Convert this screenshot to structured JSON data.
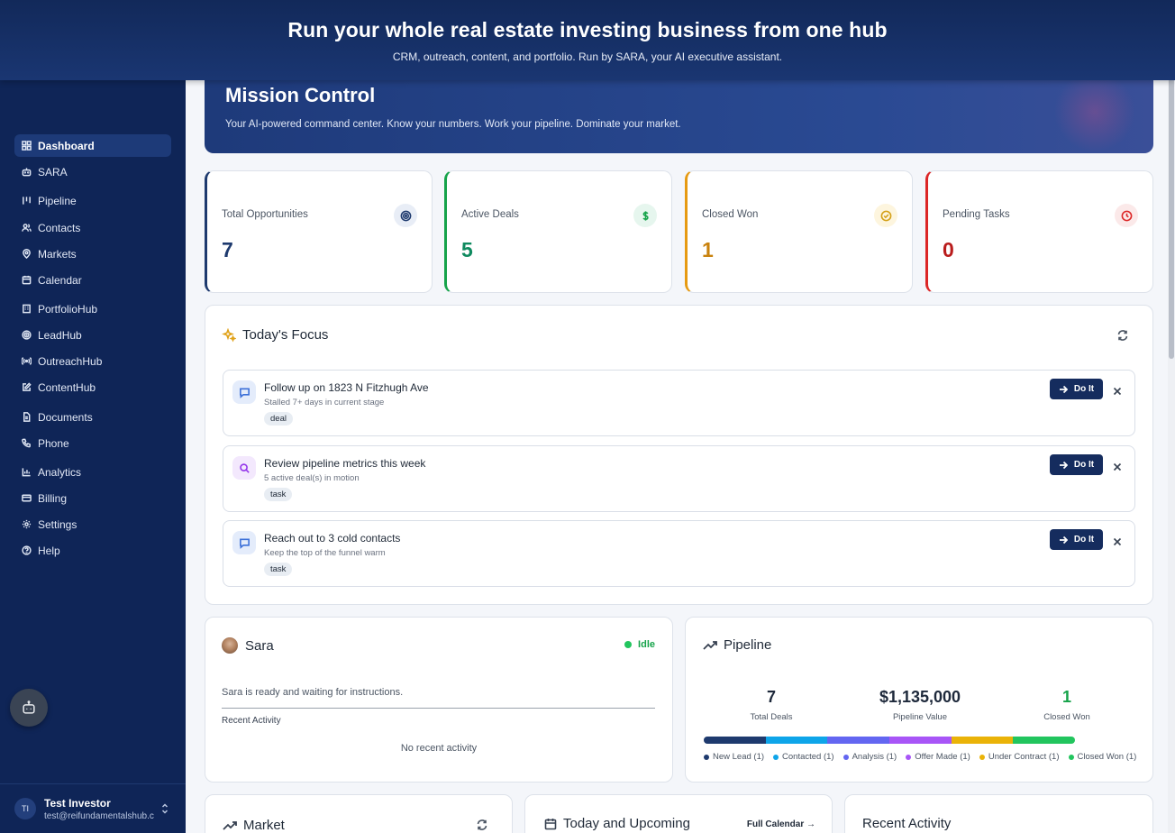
{
  "banner": {
    "title": "Run your whole real estate investing business from one hub",
    "subtitle": "CRM, outreach, content, and portfolio. Run by SARA, your AI executive assistant."
  },
  "sidebar": {
    "items": [
      {
        "label": "Dashboard",
        "icon": "grid-icon",
        "active": true
      },
      {
        "label": "SARA",
        "icon": "robot-icon"
      },
      {
        "label": "Pipeline",
        "icon": "kanban-icon"
      },
      {
        "label": "Contacts",
        "icon": "users-icon"
      },
      {
        "label": "Markets",
        "icon": "map-pin-icon"
      },
      {
        "label": "Calendar",
        "icon": "calendar-icon"
      },
      {
        "label": "PortfolioHub",
        "icon": "building-icon"
      },
      {
        "label": "LeadHub",
        "icon": "target-icon"
      },
      {
        "label": "OutreachHub",
        "icon": "broadcast-icon"
      },
      {
        "label": "ContentHub",
        "icon": "edit-icon"
      },
      {
        "label": "Documents",
        "icon": "file-icon"
      },
      {
        "label": "Phone",
        "icon": "phone-icon"
      },
      {
        "label": "Analytics",
        "icon": "bar-chart-icon"
      },
      {
        "label": "Billing",
        "icon": "credit-card-icon"
      },
      {
        "label": "Settings",
        "icon": "gear-icon"
      },
      {
        "label": "Help",
        "icon": "help-circle-icon"
      }
    ],
    "user": {
      "initials": "TI",
      "name": "Test Investor",
      "email": "test@reifundamentalshub.com"
    }
  },
  "hero": {
    "title": "Mission Control",
    "subtitle": "Your AI-powered command center. Know your numbers. Work your pipeline. Dominate your market."
  },
  "stats": [
    {
      "label": "Total Opportunities",
      "value": "7",
      "color": "#1e3a6e",
      "icon": "target-icon"
    },
    {
      "label": "Active Deals",
      "value": "5",
      "color": "#0f8a5f",
      "icon": "dollar-icon"
    },
    {
      "label": "Closed Won",
      "value": "1",
      "color": "#c9820e",
      "icon": "check-circle-icon"
    },
    {
      "label": "Pending Tasks",
      "value": "0",
      "color": "#b91c1c",
      "icon": "clock-icon"
    }
  ],
  "focus": {
    "title": "Today's Focus",
    "action_label": "Do It",
    "tasks": [
      {
        "title": "Follow up on 1823 N Fitzhugh Ave",
        "subtitle": "Stalled 7+ days in current stage",
        "tag": "deal",
        "icon": "message-icon"
      },
      {
        "title": "Review pipeline metrics this week",
        "subtitle": "5 active deal(s) in motion",
        "tag": "task",
        "icon": "search-icon"
      },
      {
        "title": "Reach out to 3 cold contacts",
        "subtitle": "Keep the top of the funnel warm",
        "tag": "task",
        "icon": "message-icon"
      }
    ]
  },
  "sara": {
    "title": "Sara",
    "status": "Idle",
    "message": "Sara is ready and waiting for instructions.",
    "recent_label": "Recent Activity",
    "empty": "No recent activity"
  },
  "pipeline": {
    "title": "Pipeline",
    "metrics": [
      {
        "value": "7",
        "label": "Total Deals"
      },
      {
        "value": "$1,135,000",
        "label": "Pipeline Value"
      },
      {
        "value": "1",
        "label": "Closed Won"
      }
    ],
    "stages": [
      {
        "name": "New Lead (1)",
        "count": 1,
        "color": "#1e3a6e"
      },
      {
        "name": "Contacted (1)",
        "count": 1,
        "color": "#0ea5e9"
      },
      {
        "name": "Analysis (1)",
        "count": 1,
        "color": "#6366f1"
      },
      {
        "name": "Offer Made (1)",
        "count": 1,
        "color": "#a855f7"
      },
      {
        "name": "Under Contract (1)",
        "count": 1,
        "color": "#eab308"
      },
      {
        "name": "Closed Won (1)",
        "count": 1,
        "color": "#22c55e"
      }
    ]
  },
  "market": {
    "title": "Market"
  },
  "calendar": {
    "title": "Today and Upcoming",
    "link": "Full Calendar →"
  },
  "recent": {
    "title": "Recent Activity"
  }
}
